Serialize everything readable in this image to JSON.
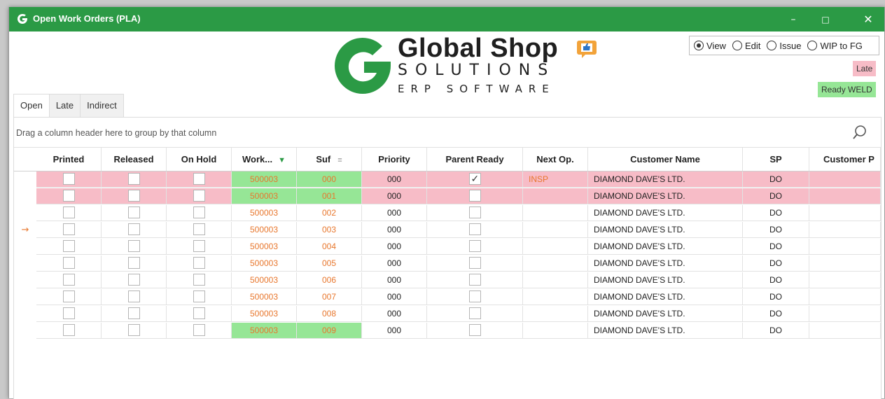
{
  "window": {
    "title": "Open Work Orders (PLA)",
    "controls": {
      "minimize": "–",
      "maximize": "□",
      "close": "✕"
    }
  },
  "logo": {
    "line1": "Global Shop",
    "line2": "SOLUTIONS",
    "line3": "ERP SOFTWARE"
  },
  "mode": {
    "options": [
      {
        "label": "View",
        "checked": true
      },
      {
        "label": "Edit",
        "checked": false
      },
      {
        "label": "Issue",
        "checked": false
      },
      {
        "label": "WIP to FG",
        "checked": false
      }
    ]
  },
  "legend": {
    "late": "Late",
    "ready_weld": "Ready WELD"
  },
  "tabs": [
    {
      "label": "Open",
      "active": true
    },
    {
      "label": "Late",
      "active": false
    },
    {
      "label": "Indirect",
      "active": false
    }
  ],
  "group_hint": "Drag a column header here to group by that column",
  "columns": [
    "Printed",
    "Released",
    "On Hold",
    "Work...",
    "Suf",
    "Priority",
    "Parent Ready",
    "Next Op.",
    "Customer Name",
    "SP",
    "Customer P"
  ],
  "rows": [
    {
      "printed": false,
      "released": false,
      "on_hold": false,
      "work_order": "500003",
      "suffix": "000",
      "priority": "000",
      "parent_ready": true,
      "next_op": "INSP",
      "customer": "DIAMOND DAVE'S LTD.",
      "sp": "DO",
      "late": true,
      "ready": true,
      "current": false
    },
    {
      "printed": false,
      "released": false,
      "on_hold": false,
      "work_order": "500003",
      "suffix": "001",
      "priority": "000",
      "parent_ready": false,
      "next_op": "",
      "customer": "DIAMOND DAVE'S LTD.",
      "sp": "DO",
      "late": true,
      "ready": true,
      "current": false
    },
    {
      "printed": false,
      "released": false,
      "on_hold": false,
      "work_order": "500003",
      "suffix": "002",
      "priority": "000",
      "parent_ready": false,
      "next_op": "",
      "customer": "DIAMOND DAVE'S LTD.",
      "sp": "DO",
      "late": false,
      "ready": false,
      "current": false
    },
    {
      "printed": false,
      "released": false,
      "on_hold": false,
      "work_order": "500003",
      "suffix": "003",
      "priority": "000",
      "parent_ready": false,
      "next_op": "",
      "customer": "DIAMOND DAVE'S LTD.",
      "sp": "DO",
      "late": false,
      "ready": false,
      "current": true
    },
    {
      "printed": false,
      "released": false,
      "on_hold": false,
      "work_order": "500003",
      "suffix": "004",
      "priority": "000",
      "parent_ready": false,
      "next_op": "",
      "customer": "DIAMOND DAVE'S LTD.",
      "sp": "DO",
      "late": false,
      "ready": false,
      "current": false
    },
    {
      "printed": false,
      "released": false,
      "on_hold": false,
      "work_order": "500003",
      "suffix": "005",
      "priority": "000",
      "parent_ready": false,
      "next_op": "",
      "customer": "DIAMOND DAVE'S LTD.",
      "sp": "DO",
      "late": false,
      "ready": false,
      "current": false
    },
    {
      "printed": false,
      "released": false,
      "on_hold": false,
      "work_order": "500003",
      "suffix": "006",
      "priority": "000",
      "parent_ready": false,
      "next_op": "",
      "customer": "DIAMOND DAVE'S LTD.",
      "sp": "DO",
      "late": false,
      "ready": false,
      "current": false
    },
    {
      "printed": false,
      "released": false,
      "on_hold": false,
      "work_order": "500003",
      "suffix": "007",
      "priority": "000",
      "parent_ready": false,
      "next_op": "",
      "customer": "DIAMOND DAVE'S LTD.",
      "sp": "DO",
      "late": false,
      "ready": false,
      "current": false
    },
    {
      "printed": false,
      "released": false,
      "on_hold": false,
      "work_order": "500003",
      "suffix": "008",
      "priority": "000",
      "parent_ready": false,
      "next_op": "",
      "customer": "DIAMOND DAVE'S LTD.",
      "sp": "DO",
      "late": false,
      "ready": false,
      "current": false
    },
    {
      "printed": false,
      "released": false,
      "on_hold": false,
      "work_order": "500003",
      "suffix": "009",
      "priority": "000",
      "parent_ready": false,
      "next_op": "",
      "customer": "DIAMOND DAVE'S LTD.",
      "sp": "DO",
      "late": false,
      "ready": true,
      "current": false
    }
  ],
  "icons": {
    "current_row": "arrow-right-icon",
    "search": "search-icon",
    "filter": "filter-icon",
    "sort": "sort-icon"
  },
  "colors": {
    "titlebar": "#2b9a45",
    "late": "#f7bcc7",
    "ready": "#96e696",
    "orange_text": "#e8772d"
  }
}
